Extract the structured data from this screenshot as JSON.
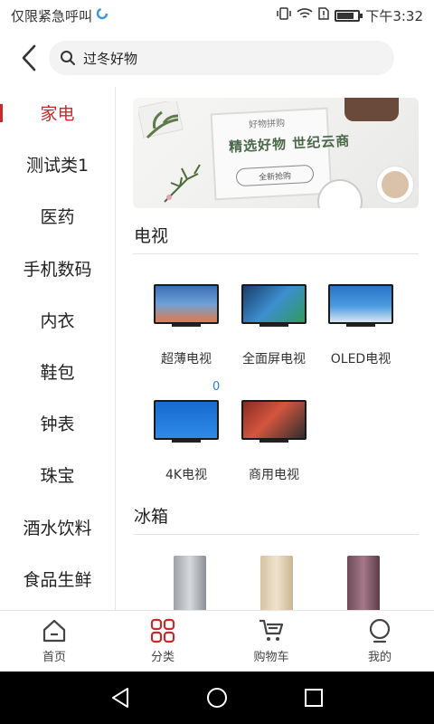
{
  "status_bar": {
    "carrier": "仅限紧急呼叫",
    "time": "下午3:32",
    "battery_level": 0.8
  },
  "search": {
    "value": "过冬好物"
  },
  "sidebar": {
    "items": [
      {
        "label": "家电",
        "active": true
      },
      {
        "label": "测试类1",
        "active": false
      },
      {
        "label": "医药",
        "active": false
      },
      {
        "label": "手机数码",
        "active": false
      },
      {
        "label": "内衣",
        "active": false
      },
      {
        "label": "鞋包",
        "active": false
      },
      {
        "label": "钟表",
        "active": false
      },
      {
        "label": "珠宝",
        "active": false
      },
      {
        "label": "酒水饮料",
        "active": false
      },
      {
        "label": "食品生鲜",
        "active": false
      }
    ]
  },
  "banner": {
    "small_text": "好物拼购",
    "headline": "精选好物  世纪云商",
    "button_text": "全新抢购"
  },
  "sections": [
    {
      "title": "电视",
      "items": [
        {
          "label": "超薄电视"
        },
        {
          "label": "全面屏电视"
        },
        {
          "label": "OLED电视"
        },
        {
          "label": "4K电视"
        },
        {
          "label": "商用电视"
        }
      ],
      "badge": "0"
    },
    {
      "title": "冰箱"
    }
  ],
  "tabbar": {
    "items": [
      {
        "label": "首页",
        "icon": "home-icon"
      },
      {
        "label": "分类",
        "icon": "category-icon",
        "active": true
      },
      {
        "label": "购物车",
        "icon": "cart-icon"
      },
      {
        "label": "我的",
        "icon": "profile-icon"
      }
    ]
  },
  "colors": {
    "accent": "#c82a2a",
    "badge_blue": "#2a7ad8"
  }
}
